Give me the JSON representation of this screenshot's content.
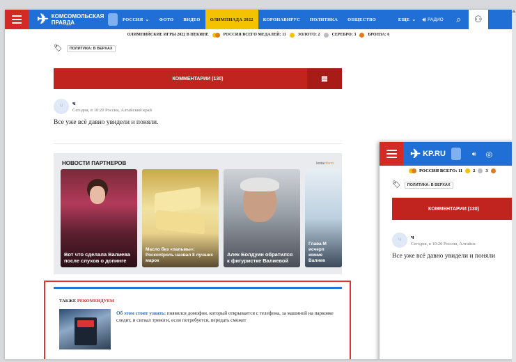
{
  "topnav": {
    "logo_line1": "Комсомольская",
    "logo_line2": "правда",
    "items": [
      "РОССИЯ",
      "ФОТО",
      "ВИДЕО",
      "ОЛИМПИАДА 2022",
      "КОРОНАВИРУС",
      "ПОЛИТИКА",
      "ОБЩЕСТВО",
      "ЕЩЕ"
    ],
    "radio_label": "РАДИО"
  },
  "subbar": {
    "title": "ОЛИМПИЙСКИЕ ИГРЫ 2022 В ПЕКИНЕ",
    "medals_label": "РОССИЯ ВСЕГО МЕДАЛЕЙ: 11",
    "gold": "ЗОЛОТО: 2",
    "silver": "СЕРЕБРО: 3",
    "bronze": "БРОНЗА: 6"
  },
  "article": {
    "tag": "ПОЛИТИКА: В ВЕРХАХ",
    "comments_button": "КОММЕНТАРИИ (130)"
  },
  "comment": {
    "avatar_text": "Ч",
    "author": "ч",
    "meta": "Сегодня, в 10:20   Россия, Алтайский край",
    "text": "Все уже всё давно увидели и поняли."
  },
  "partners": {
    "title": "НОВОСТИ ПАРТНЕРОВ",
    "brand_left": "lenta",
    "brand_right": "inform",
    "cards": [
      {
        "caption": "Вот что сделала Валиева после слухов о допинге"
      },
      {
        "caption": "Масло без «пальмы»: Роскontроль назвал 8 лучших марок"
      },
      {
        "caption": "Алек Болдуин обратился к фигуристке Валиевой"
      },
      {
        "caption": "Глава М исчерп комме Валиев"
      }
    ]
  },
  "recommend": {
    "heading_a": "ТАКЖЕ",
    "heading_b": "РЕКОМЕНДУЕМ",
    "link": "Об этом стоит узнать:",
    "text": " появился домофон, который открывается с телефона, за машиной на парковке следит, и сигнал тревоги, если потребуется, передать сможет"
  },
  "mobile": {
    "logo": "KP.RU",
    "medals_label": "РОССИЯ ВСЕГО: 11",
    "gold": "2",
    "silver": "3",
    "tag": "ПОЛИТИКА: В ВЕРХАХ",
    "comments_button": "КОММЕНТАРИИ (130)",
    "comment_author": "ч",
    "comment_meta": "Сегодня, в 10:20   Россия, Алтайск",
    "comment_text": "Все уже всё давно увидели и поняли"
  },
  "colors": {
    "brand_blue": "#1f6fd6",
    "brand_red": "#c1231e",
    "olympiad_yellow": "#f3c300",
    "gold": "#f2c200",
    "silver": "#b8bcc2",
    "bronze": "#e07a1c"
  },
  "icons": [
    "menu-icon",
    "radio-icon",
    "search-icon",
    "user-icon",
    "tag-icon",
    "comment-icon",
    "location-icon"
  ]
}
